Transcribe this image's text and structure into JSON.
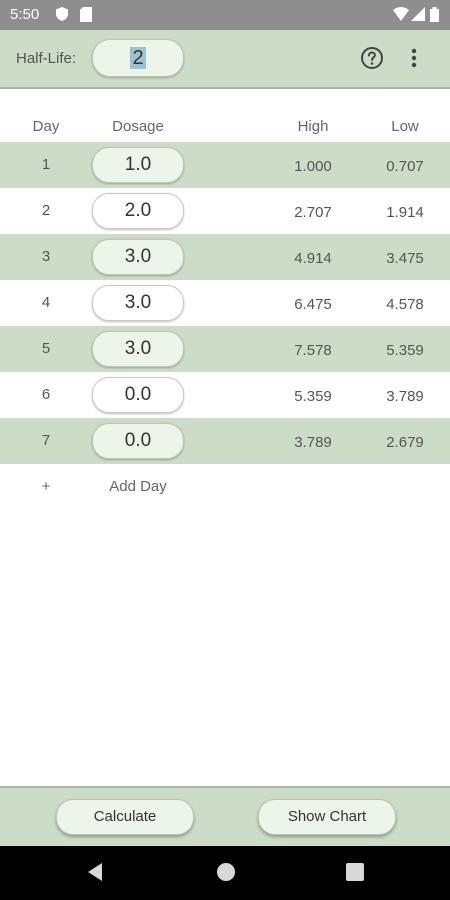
{
  "status_bar": {
    "time": "5:50",
    "icons": [
      "shield-icon",
      "sim-icon",
      "wifi-icon",
      "signal-icon",
      "battery-icon"
    ]
  },
  "app_bar": {
    "half_life_label": "Half-Life:",
    "half_life_value": "2",
    "icons": [
      "help-icon",
      "more-vert-icon"
    ]
  },
  "table": {
    "headers": {
      "day": "Day",
      "dosage": "Dosage",
      "high": "High",
      "low": "Low"
    },
    "rows": [
      {
        "day": "1",
        "dosage": "1.0",
        "high": "1.000",
        "low": "0.707"
      },
      {
        "day": "2",
        "dosage": "2.0",
        "high": "2.707",
        "low": "1.914"
      },
      {
        "day": "3",
        "dosage": "3.0",
        "high": "4.914",
        "low": "3.475"
      },
      {
        "day": "4",
        "dosage": "3.0",
        "high": "6.475",
        "low": "4.578"
      },
      {
        "day": "5",
        "dosage": "3.0",
        "high": "7.578",
        "low": "5.359"
      },
      {
        "day": "6",
        "dosage": "0.0",
        "high": "5.359",
        "low": "3.789"
      },
      {
        "day": "7",
        "dosage": "0.0",
        "high": "3.789",
        "low": "2.679"
      }
    ],
    "add_day": {
      "icon": "+",
      "label": "Add Day"
    }
  },
  "buttons": {
    "calculate": "Calculate",
    "show_chart": "Show Chart"
  },
  "colors": {
    "accent_green": "#ccdcc6",
    "field_green": "#edf4ea",
    "status_bar": "#8e8e8e",
    "nav_bar": "#000000"
  }
}
